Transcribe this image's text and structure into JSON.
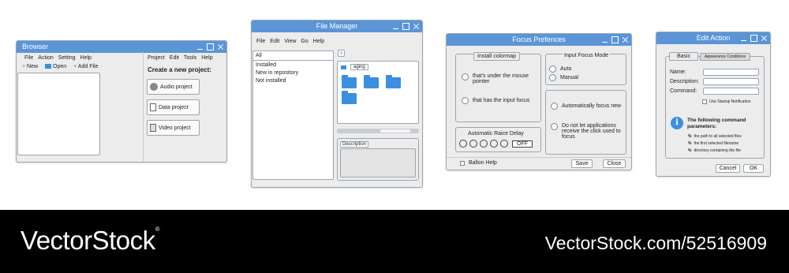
{
  "browser": {
    "title": "Browser",
    "menu": [
      "File",
      "Action",
      "Setting",
      "Help"
    ],
    "toolbar": {
      "new": "New",
      "open": "Open",
      "add_file": "Add File"
    },
    "right_menu": [
      "Project",
      "Edit",
      "Tools",
      "Help"
    ],
    "create_heading": "Create a new project:",
    "buttons": {
      "audio": "Audio project",
      "data": "Data project",
      "video": "Video project"
    }
  },
  "file_manager": {
    "title": "File Manager",
    "menu": [
      "File",
      "Edit",
      "View",
      "Go",
      "Help"
    ],
    "filter_all": "All",
    "list": [
      "Installed",
      "New in repository",
      "Not installed"
    ],
    "path_segment": "aging",
    "description_label": "Description"
  },
  "focus_prefs": {
    "title": "Focus Prefences",
    "tab_install": "Install colormap",
    "install_options": [
      "that's under the mouse pointer",
      "that has the input focus"
    ],
    "input_focus_mode": "Input Focus Mode",
    "focus_options": [
      "Auto",
      "Manual"
    ],
    "auto_focus_options": [
      "Automatically focus new",
      "Do not let applications receive the click used to focus"
    ],
    "raise_delay_label": "Automatic Raice Delay",
    "raise_toggle": "OFF",
    "balloon_help": "Ballon Help",
    "save": "Save",
    "close": "Close"
  },
  "edit_action": {
    "title": "Edit Action",
    "tabs": [
      "Basic",
      "Appearance Conditions"
    ],
    "fields": {
      "name": "Name:",
      "description": "Description:",
      "command": "Command:"
    },
    "startup": "Use Startup Notification",
    "params_title": "The following command parameters:",
    "params": [
      "the path to all selected files",
      "the first selected filename",
      "directory containing the file"
    ],
    "param_prefix": "%",
    "cancel": "Cancel",
    "ok": "OK"
  },
  "footer": {
    "brand": "VectorStock",
    "registered": "®",
    "url": "VectorStock.com/52516909"
  },
  "colors": {
    "titlebar": "#5b95d8",
    "folder": "#3a8fe0",
    "footer": "#000000"
  }
}
